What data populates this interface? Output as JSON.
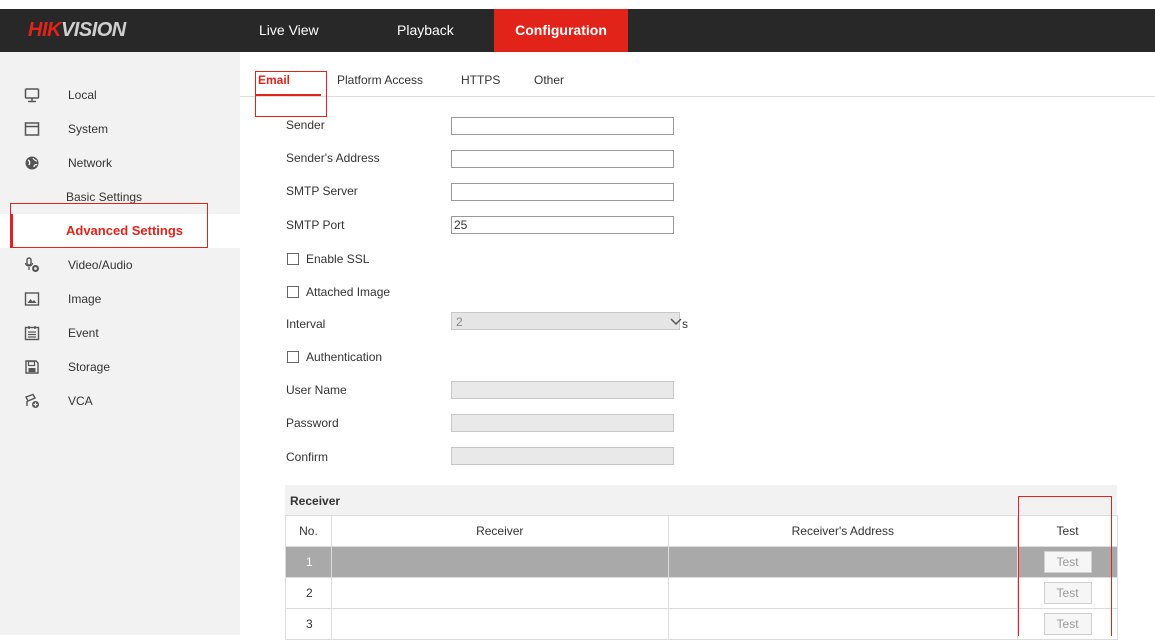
{
  "header": {
    "logo_red": "HIK",
    "logo_rest": "VISION",
    "nav": [
      {
        "label": "Live View"
      },
      {
        "label": "Playback"
      },
      {
        "label": "Configuration"
      }
    ]
  },
  "sidebar": {
    "items": [
      {
        "label": "Local",
        "icon": "monitor-icon"
      },
      {
        "label": "System",
        "icon": "system-window-icon"
      },
      {
        "label": "Network",
        "icon": "globe-icon"
      },
      {
        "label": "Basic Settings"
      },
      {
        "label": "Advanced Settings"
      },
      {
        "label": "Video/Audio",
        "icon": "microphone-camera-icon"
      },
      {
        "label": "Image",
        "icon": "image-icon"
      },
      {
        "label": "Event",
        "icon": "calendar-icon"
      },
      {
        "label": "Storage",
        "icon": "floppy-disk-icon"
      },
      {
        "label": "VCA",
        "icon": "vca-camera-icon"
      }
    ]
  },
  "tabs": [
    {
      "label": "Email"
    },
    {
      "label": "Platform Access"
    },
    {
      "label": "HTTPS"
    },
    {
      "label": "Other"
    }
  ],
  "form": {
    "sender_label": "Sender",
    "sender_value": "",
    "sender_address_label": "Sender's Address",
    "sender_address_value": "",
    "smtp_server_label": "SMTP Server",
    "smtp_server_value": "",
    "smtp_port_label": "SMTP Port",
    "smtp_port_value": "25",
    "enable_ssl_label": "Enable SSL",
    "enable_ssl_checked": false,
    "attached_image_label": "Attached Image",
    "attached_image_checked": false,
    "interval_label": "Interval",
    "interval_value": "2",
    "interval_unit": "s",
    "authentication_label": "Authentication",
    "authentication_checked": false,
    "username_label": "User Name",
    "password_label": "Password",
    "confirm_label": "Confirm"
  },
  "receiver": {
    "title": "Receiver",
    "columns": [
      "No.",
      "Receiver",
      "Receiver's Address",
      "Test"
    ],
    "rows": [
      {
        "no": "1",
        "receiver": "",
        "address": "",
        "test": "Test",
        "selected": true
      },
      {
        "no": "2",
        "receiver": "",
        "address": "",
        "test": "Test",
        "selected": false
      },
      {
        "no": "3",
        "receiver": "",
        "address": "",
        "test": "Test",
        "selected": false
      }
    ]
  },
  "colors": {
    "accent": "#e2231a",
    "topbar": "#282828",
    "sidebar_bg": "#f2f2f2",
    "selected_row": "#a9a9a9"
  }
}
